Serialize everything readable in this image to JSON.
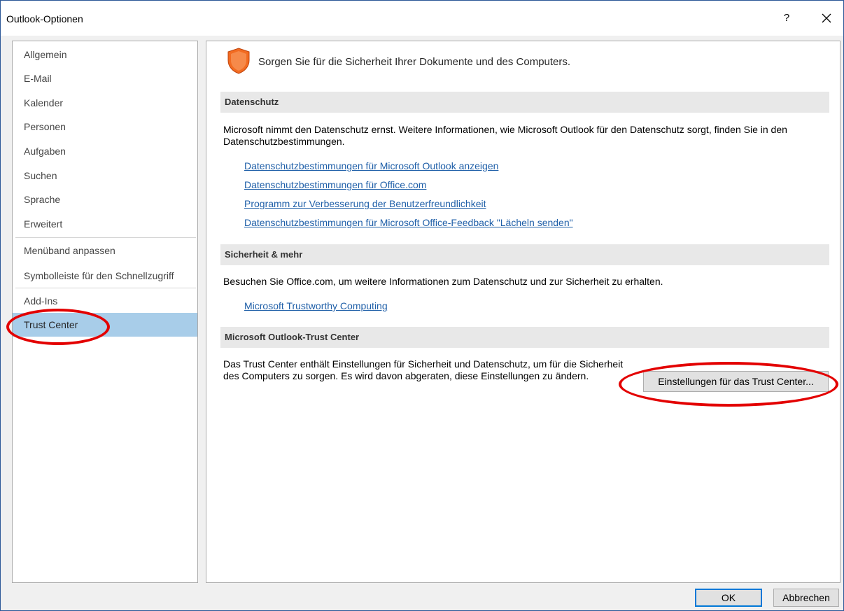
{
  "window": {
    "title": "Outlook-Optionen",
    "help_label": "?",
    "close_icon": "close-icon"
  },
  "nav": {
    "items": [
      {
        "label": "Allgemein"
      },
      {
        "label": "E-Mail"
      },
      {
        "label": "Kalender"
      },
      {
        "label": "Personen"
      },
      {
        "label": "Aufgaben"
      },
      {
        "label": "Suchen"
      },
      {
        "label": "Sprache"
      },
      {
        "label": "Erweitert"
      },
      {
        "label": "Menüband anpassen"
      },
      {
        "label": "Symbolleiste für den Schnellzugriff"
      },
      {
        "label": "Add-Ins"
      },
      {
        "label": "Trust Center",
        "selected": true
      }
    ]
  },
  "content": {
    "header_icon": "shield-icon",
    "header_text": "Sorgen Sie für die Sicherheit Ihrer Dokumente und des Computers.",
    "privacy": {
      "title": "Datenschutz",
      "text": "Microsoft nimmt den Datenschutz ernst. Weitere Informationen, wie Microsoft Outlook für den Datenschutz sorgt, finden Sie in den Datenschutzbestimmungen.",
      "links": [
        "Datenschutzbestimmungen für Microsoft Outlook anzeigen",
        "Datenschutzbestimmungen für Office.com",
        "Programm zur Verbesserung der Benutzerfreundlichkeit",
        "Datenschutzbestimmungen für Microsoft Office-Feedback \"Lächeln senden\""
      ]
    },
    "security": {
      "title": "Sicherheit & mehr",
      "text": "Besuchen Sie Office.com, um weitere Informationen zum Datenschutz und zur Sicherheit zu erhalten.",
      "link": "Microsoft Trustworthy Computing"
    },
    "trust_center": {
      "title": "Microsoft Outlook-Trust Center",
      "text": "Das Trust Center enthält Einstellungen für Sicherheit und Datenschutz, um für die Sicherheit des Computers zu sorgen. Es wird davon abgeraten, diese Einstellungen zu ändern.",
      "button_label": "Einstellungen für das Trust Center..."
    }
  },
  "footer": {
    "ok_label": "OK",
    "cancel_label": "Abbrechen"
  },
  "annotations": {
    "highlight_color": "#e30000"
  }
}
